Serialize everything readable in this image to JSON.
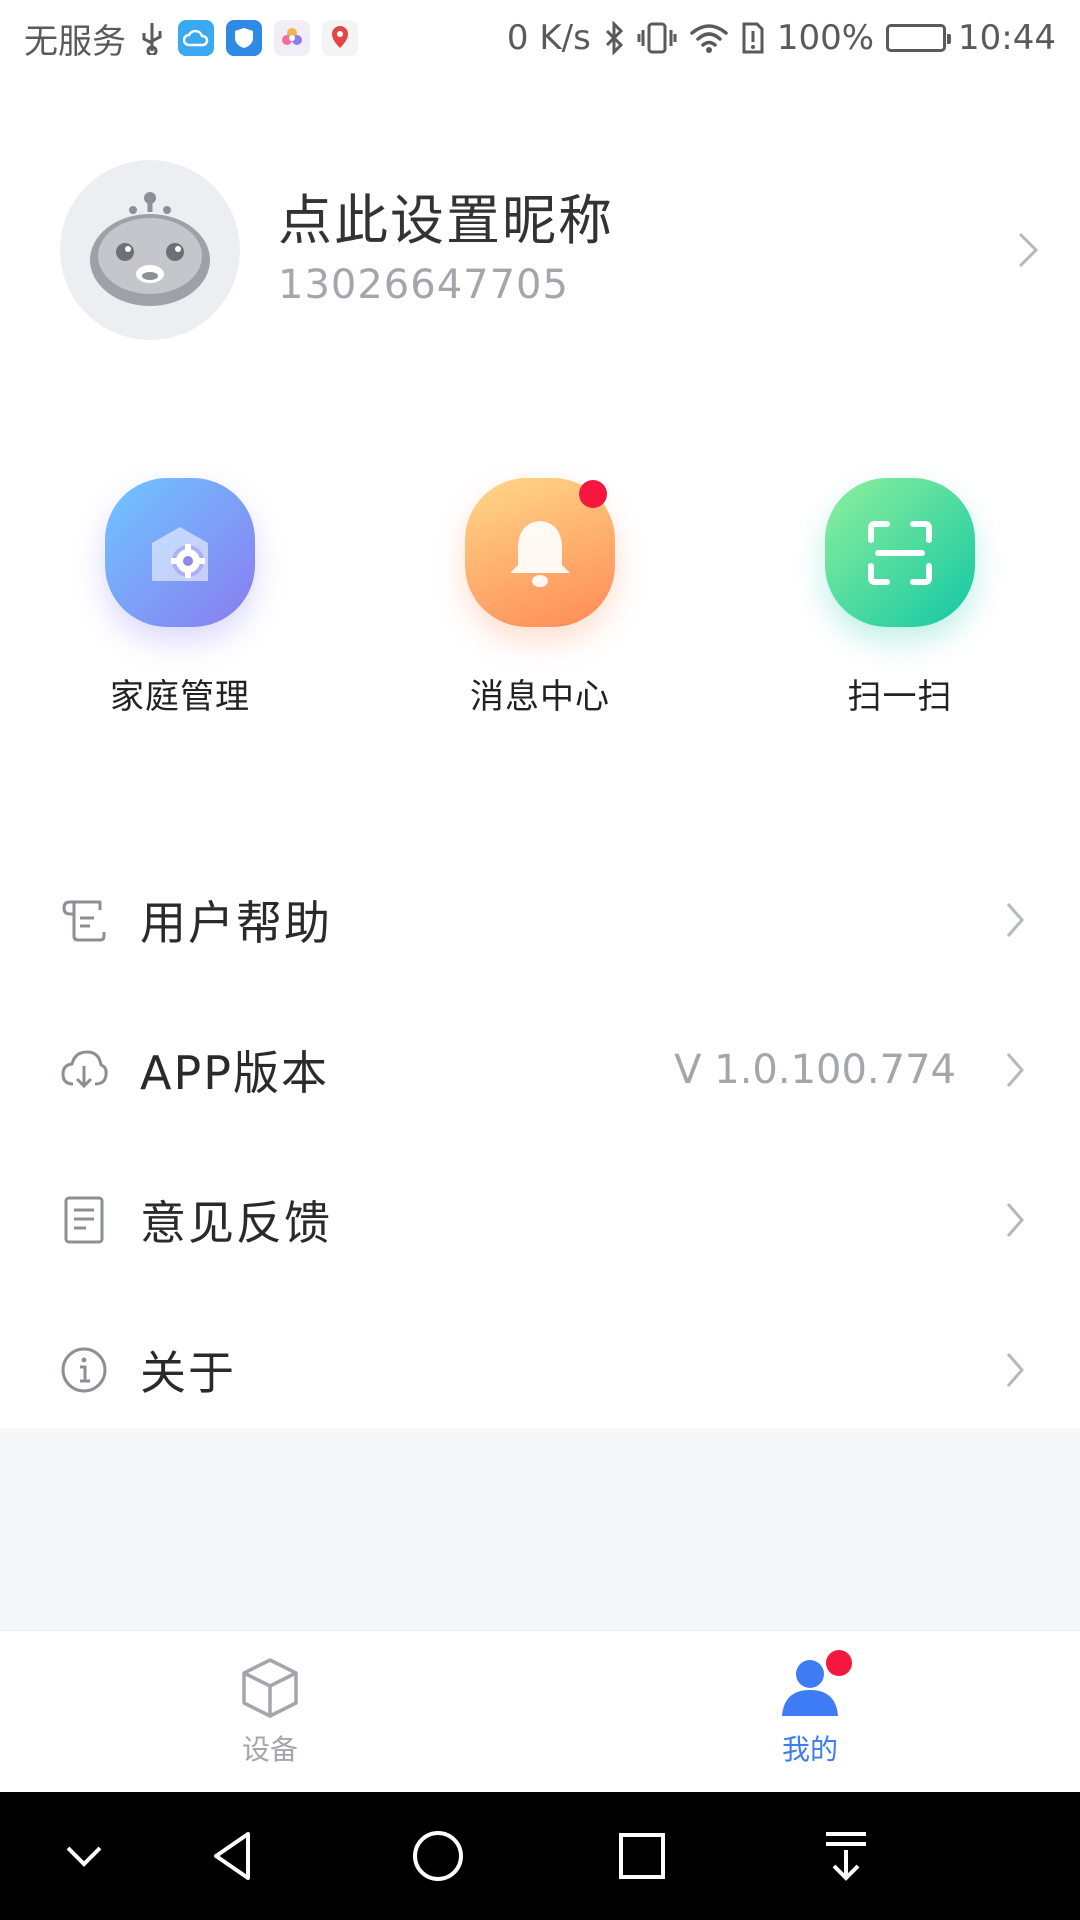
{
  "status_bar": {
    "carrier": "无服务",
    "speed": "0 K/s",
    "battery": "100%",
    "time": "10:44",
    "icons": [
      "usb-icon",
      "cloud-app-icon",
      "shield-app-icon",
      "flower-app-icon",
      "map-app-icon",
      "bluetooth-icon",
      "vibrate-icon",
      "wifi-icon",
      "sim-alert-icon",
      "battery-icon"
    ]
  },
  "profile": {
    "nickname": "点此设置昵称",
    "phone": "13026647705"
  },
  "quick_actions": [
    {
      "label": "家庭管理",
      "icon": "home-settings-icon"
    },
    {
      "label": "消息中心",
      "icon": "bell-icon"
    },
    {
      "label": "扫一扫",
      "icon": "scan-icon"
    }
  ],
  "menu": {
    "help": {
      "label": "用户帮助",
      "icon": "help-scroll-icon"
    },
    "version": {
      "label": "APP版本",
      "value": "V 1.0.100.774",
      "icon": "cloud-download-icon"
    },
    "feedback": {
      "label": "意见反馈",
      "icon": "document-icon"
    },
    "about": {
      "label": "关于",
      "icon": "info-icon"
    }
  },
  "tabs": {
    "devices": {
      "label": "设备",
      "icon": "cube-icon"
    },
    "mine": {
      "label": "我的",
      "icon": "user-icon"
    }
  },
  "colors": {
    "accent": "#3d7cf5",
    "badge": "#f5173e",
    "muted_text": "#a3a6ad"
  }
}
